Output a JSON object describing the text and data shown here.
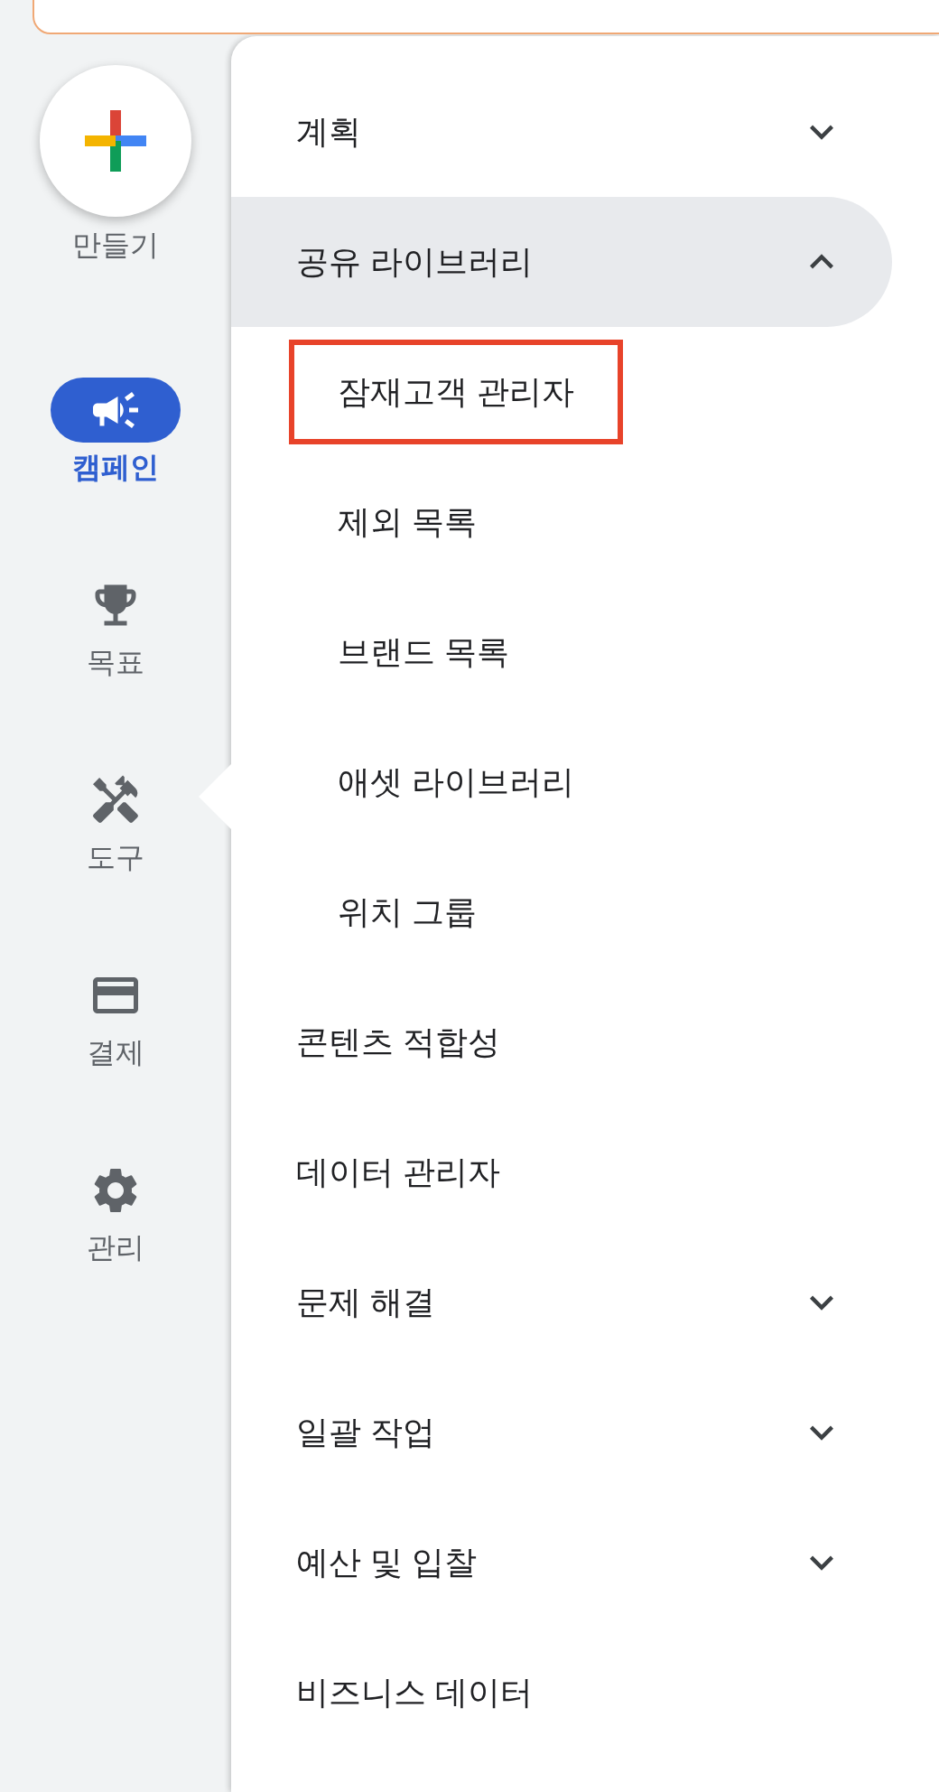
{
  "rail": [
    {
      "kind": "create",
      "label": "만들기",
      "selected": false
    },
    {
      "kind": "campaign",
      "label": "캠페인",
      "selected": true
    },
    {
      "kind": "goals",
      "label": "목표",
      "selected": false
    },
    {
      "kind": "tools",
      "label": "도구",
      "selected": false,
      "open": true
    },
    {
      "kind": "billing",
      "label": "결제",
      "selected": false
    },
    {
      "kind": "admin",
      "label": "관리",
      "selected": false
    }
  ],
  "menu": [
    {
      "kind": "group",
      "label": "계획",
      "expanded": false
    },
    {
      "kind": "group",
      "label": "공유 라이브러리",
      "expanded": true,
      "children": [
        {
          "label": "잠재고객 관리자",
          "highlighted": true
        },
        {
          "label": "제외 목록",
          "highlighted": false
        },
        {
          "label": "브랜드 목록",
          "highlighted": false
        },
        {
          "label": "애셋 라이브러리",
          "highlighted": false
        },
        {
          "label": "위치 그룹",
          "highlighted": false
        }
      ]
    },
    {
      "kind": "link",
      "label": "콘텐츠 적합성"
    },
    {
      "kind": "link",
      "label": "데이터 관리자"
    },
    {
      "kind": "group",
      "label": "문제 해결",
      "expanded": false
    },
    {
      "kind": "group",
      "label": "일괄 작업",
      "expanded": false
    },
    {
      "kind": "group",
      "label": "예산 및 입찰",
      "expanded": false
    },
    {
      "kind": "link",
      "label": "비즈니스 데이터"
    }
  ]
}
